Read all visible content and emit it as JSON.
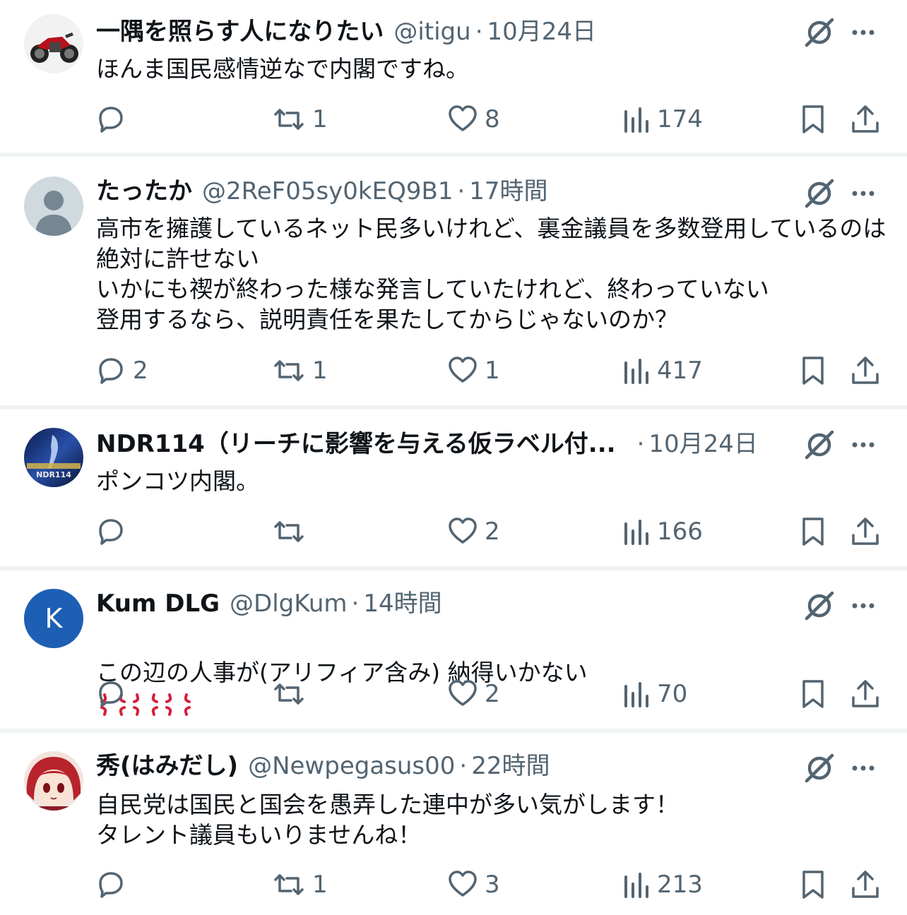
{
  "tweets": [
    {
      "display_name": "一隅を照らす人になりたい",
      "handle": "@itigu",
      "dot": "·",
      "time": "10月24日",
      "text": "ほんま国民感情逆なで内閣ですね。",
      "reply_count": "",
      "retweet_count": "1",
      "like_count": "8",
      "view_count": "174",
      "avatar": "motorcycle-avatar"
    },
    {
      "display_name": "たったか",
      "handle": "@2ReF05sy0kEQ9B1",
      "dot": "·",
      "time": "17時間",
      "text": "高市を擁護しているネット民多いけれど、裏金議員を多数登用しているのは絶対に許せない\nいかにも禊が終わった様な発言していたけれど、終わっていない\n登用するなら、説明責任を果たしてからじゃないのか？",
      "reply_count": "2",
      "retweet_count": "1",
      "like_count": "1",
      "view_count": "417",
      "avatar": "default-avatar"
    },
    {
      "display_name": "NDR114（リーチに影響を与える仮ラベル付...",
      "handle": "",
      "dot": "·",
      "time": "10月24日",
      "text": "ポンコツ内閣。",
      "reply_count": "",
      "retweet_count": "",
      "like_count": "2",
      "view_count": "166",
      "avatar": "movie-poster-avatar",
      "avatar_text": "NDR114"
    },
    {
      "display_name": "Kum DLG",
      "handle": "@DlgKum",
      "dot": "·",
      "time": "14時間",
      "text": "この辺の人事が(アリフィア含み) 納得いかない",
      "reply_count": "",
      "retweet_count": "",
      "like_count": "2",
      "view_count": "70",
      "avatar": "letter-avatar",
      "avatar_letter": "K",
      "avatar_color": "#1d5fb4"
    },
    {
      "display_name": "秀(はみだし)",
      "handle": "@Newpegasus00",
      "dot": "·",
      "time": "22時間",
      "text": "自民党は国民と国会を愚弄した連中が多い気がします！\nタレント議員もいりませんね！",
      "reply_count": "",
      "retweet_count": "1",
      "like_count": "3",
      "view_count": "213",
      "avatar": "anime-avatar"
    }
  ],
  "colors": {
    "text": "#0f1419",
    "secondary": "#536471",
    "divider": "#eff3f4",
    "anger": "#d81e3c"
  },
  "icons": [
    "reply-icon",
    "retweet-icon",
    "like-icon",
    "views-icon",
    "bookmark-icon",
    "share-icon",
    "grok-icon",
    "more-icon",
    "anger-emoji"
  ]
}
